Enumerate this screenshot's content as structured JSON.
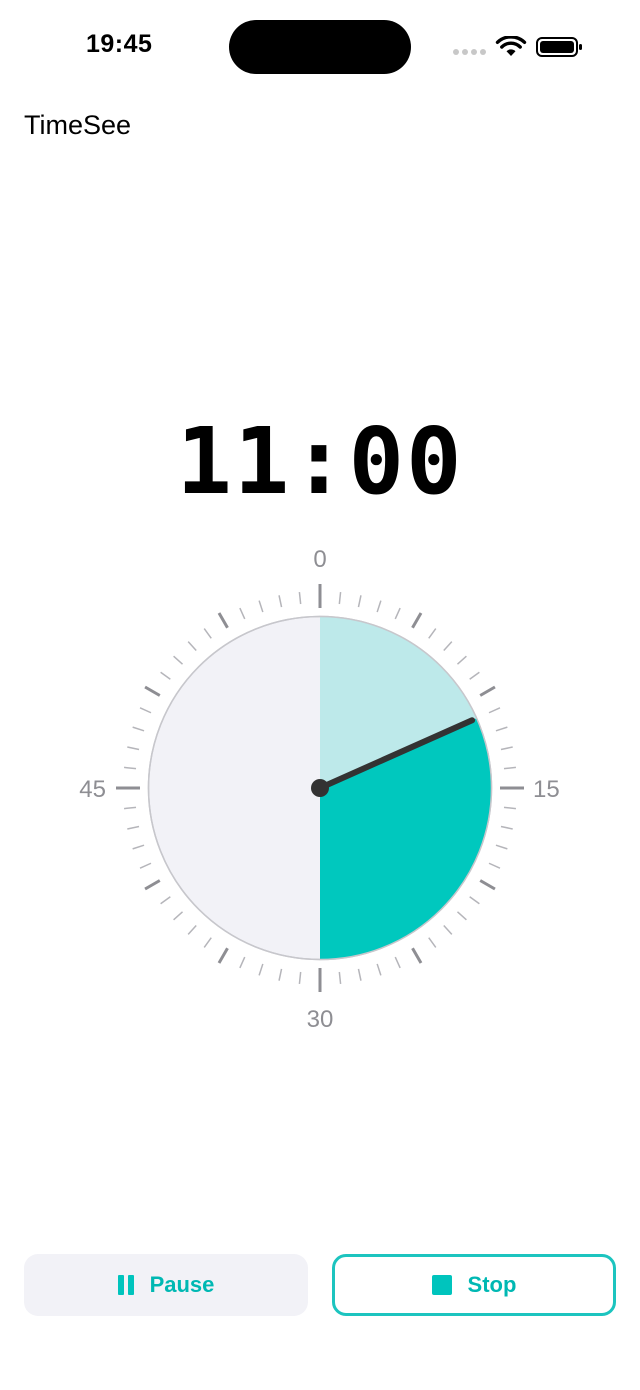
{
  "status_bar": {
    "time": "19:45"
  },
  "app": {
    "title": "TimeSee"
  },
  "timer": {
    "display": "11:00",
    "elapsed_minutes": 11,
    "remaining_minutes": 19,
    "total_minutes": 30
  },
  "dial": {
    "labels": {
      "top": "0",
      "right": "15",
      "bottom": "30",
      "left": "45"
    },
    "colors": {
      "remaining": "#00c8be",
      "elapsed": "#bde9ea",
      "inactive": "#f2f2f7",
      "hand": "#333333"
    }
  },
  "buttons": {
    "pause_label": "Pause",
    "stop_label": "Stop"
  },
  "colors": {
    "accent": "#00b8b3"
  }
}
